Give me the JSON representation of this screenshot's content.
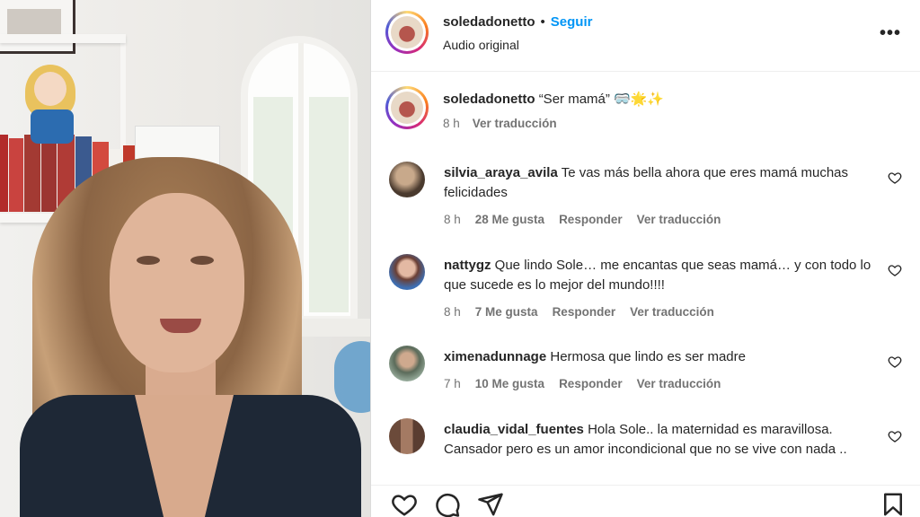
{
  "post": {
    "author": "soledadonetto",
    "follow_label": "Seguir",
    "separator": "•",
    "audio": "Audio original",
    "more": "•••"
  },
  "caption": {
    "author": "soledadonetto",
    "text": "“Ser mamá”",
    "emojis": "🥽🌟✨",
    "time": "8 h",
    "translate": "Ver traducción"
  },
  "comments": [
    {
      "user": "silvia_araya_avila",
      "text": "Te vas más bella ahora que eres mamá muchas felicidades",
      "time": "8 h",
      "likes": "28 Me gusta",
      "reply": "Responder",
      "translate": "Ver traducción"
    },
    {
      "user": "nattygz",
      "text": "Que lindo Sole… me encantas que seas mamá… y con todo lo que sucede es lo mejor del mundo!!!!",
      "time": "8 h",
      "likes": "7 Me gusta",
      "reply": "Responder",
      "translate": "Ver traducción"
    },
    {
      "user": "ximenadunnage",
      "text": "Hermosa que lindo es ser madre",
      "time": "7 h",
      "likes": "10 Me gusta",
      "reply": "Responder",
      "translate": "Ver traducción"
    },
    {
      "user": "claudia_vidal_fuentes",
      "text": "Hola Sole.. la maternidad es maravillosa. Cansador pero es un amor incondicional que no se vive con nada ..",
      "time": "",
      "likes": "",
      "reply": "",
      "translate": ""
    }
  ],
  "icons": {
    "like": "heart-icon",
    "comment": "comment-icon",
    "share": "send-icon",
    "save": "bookmark-icon",
    "comment_like": "heart-outline-icon"
  },
  "colors": {
    "link": "#0095f6",
    "secondary_text": "#737373",
    "primary_text": "#262626"
  }
}
